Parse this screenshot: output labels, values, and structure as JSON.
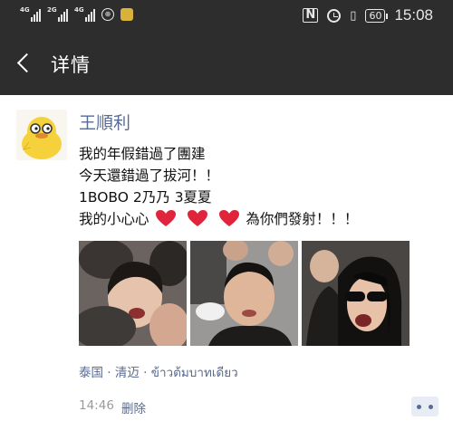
{
  "status_bar": {
    "net1": "4G",
    "net2": "2G",
    "net3": "4G",
    "nfc": "N",
    "battery": "60",
    "time": "15:08"
  },
  "nav": {
    "title": "详情"
  },
  "post": {
    "author": "王順利",
    "lines": [
      "我的年假錯過了團建",
      "今天還錯過了拔河！！",
      "1BOBO 2乃乃 3夏夏",
      "我的小心心",
      "為你們發射！！！"
    ],
    "location": "泰国 · 清迈 · ข้าวต้มบาทเดียว",
    "time": "14:46",
    "delete_label": "删除"
  },
  "colors": {
    "bar_bg": "#2d2d2d",
    "link": "#576b95",
    "heart": "#e0243c",
    "avatar_yellow": "#f5d23b"
  }
}
